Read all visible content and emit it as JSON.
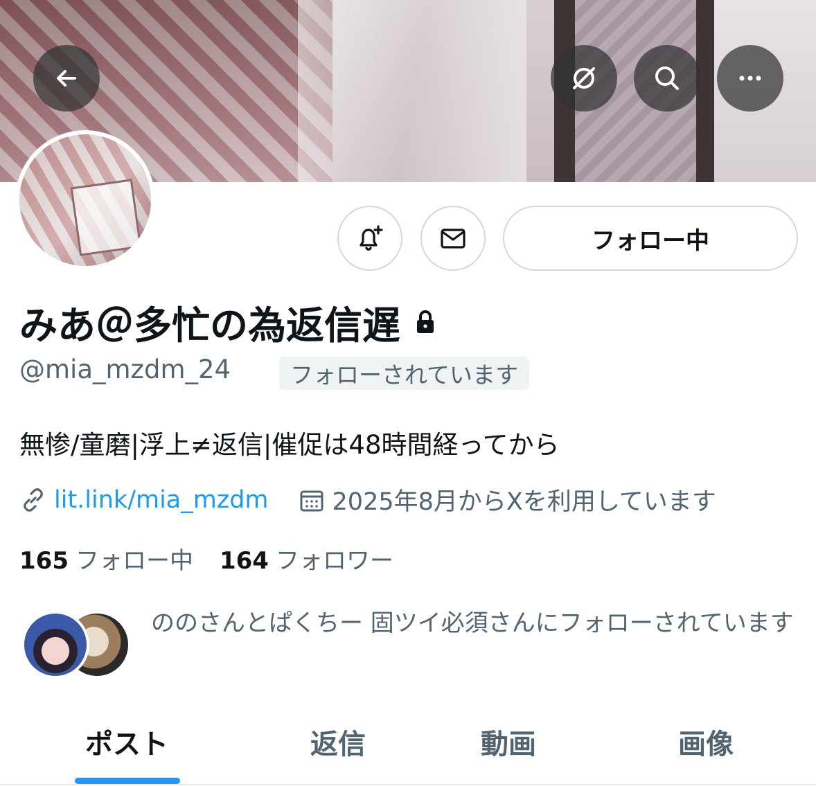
{
  "banner": {
    "has_image": true
  },
  "toolbar": {
    "back_icon": "arrow-left-icon",
    "grok_icon": "grok-icon",
    "search_icon": "search-icon",
    "more_icon": "more-horizontal-icon"
  },
  "actions": {
    "notify_icon": "bell-plus-icon",
    "message_icon": "mail-icon",
    "follow_label": "フォロー中"
  },
  "profile": {
    "display_name": "みあ＠多忙の為返信遅",
    "protected_icon": "lock-icon",
    "handle": "@mia_mzdm_24",
    "follows_you": "フォローされています",
    "bio": "無惨/童磨|浮上≠返信|催促は48時間経ってから",
    "link": "lit.link/mia_mzdm",
    "joined": "2025年8月からXを利用しています"
  },
  "stats": {
    "following_count": "165",
    "following_label": "フォロー中",
    "followers_count": "164",
    "followers_label": "フォロワー"
  },
  "followed_by": {
    "text": "ののさんとぱくちー 固ツイ必須さんにフォローされています"
  },
  "tabs": [
    {
      "label": "ポスト",
      "active": true
    },
    {
      "label": "返信",
      "active": false
    },
    {
      "label": "動画",
      "active": false
    },
    {
      "label": "画像",
      "active": false
    }
  ],
  "colors": {
    "accent": "#1d9bf0",
    "secondary_text": "#536471",
    "primary_text": "#0f1419",
    "border": "#cfd9de"
  }
}
